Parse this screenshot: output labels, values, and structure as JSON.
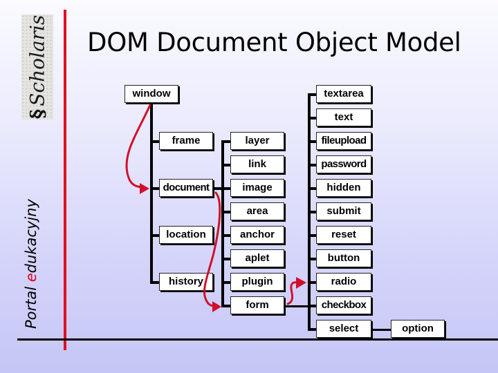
{
  "title": "DOM Document Object Model",
  "branding": {
    "logo_text": "Scholaris",
    "side_text_before": "Portal ",
    "side_text_accent": "e",
    "side_text_after": "dukacyjny",
    "accent_color": "#e0001a",
    "rule_color": "#e01020"
  },
  "diagram": {
    "root": "window",
    "window_children": [
      "frame",
      "document",
      "location",
      "history"
    ],
    "document_children": [
      "layer",
      "link",
      "image",
      "area",
      "anchor",
      "aplet",
      "plugin",
      "form"
    ],
    "form_children": [
      "textarea",
      "text",
      "fileupload",
      "password",
      "hidden",
      "submit",
      "reset",
      "button",
      "radio",
      "checkbox",
      "select"
    ],
    "select_children": [
      "option"
    ],
    "arrow_color": "#d0102a",
    "arrows": [
      {
        "from": "window",
        "to": "document"
      },
      {
        "from": "document",
        "to": "form"
      },
      {
        "from": "form",
        "to": "form-elements"
      }
    ]
  }
}
